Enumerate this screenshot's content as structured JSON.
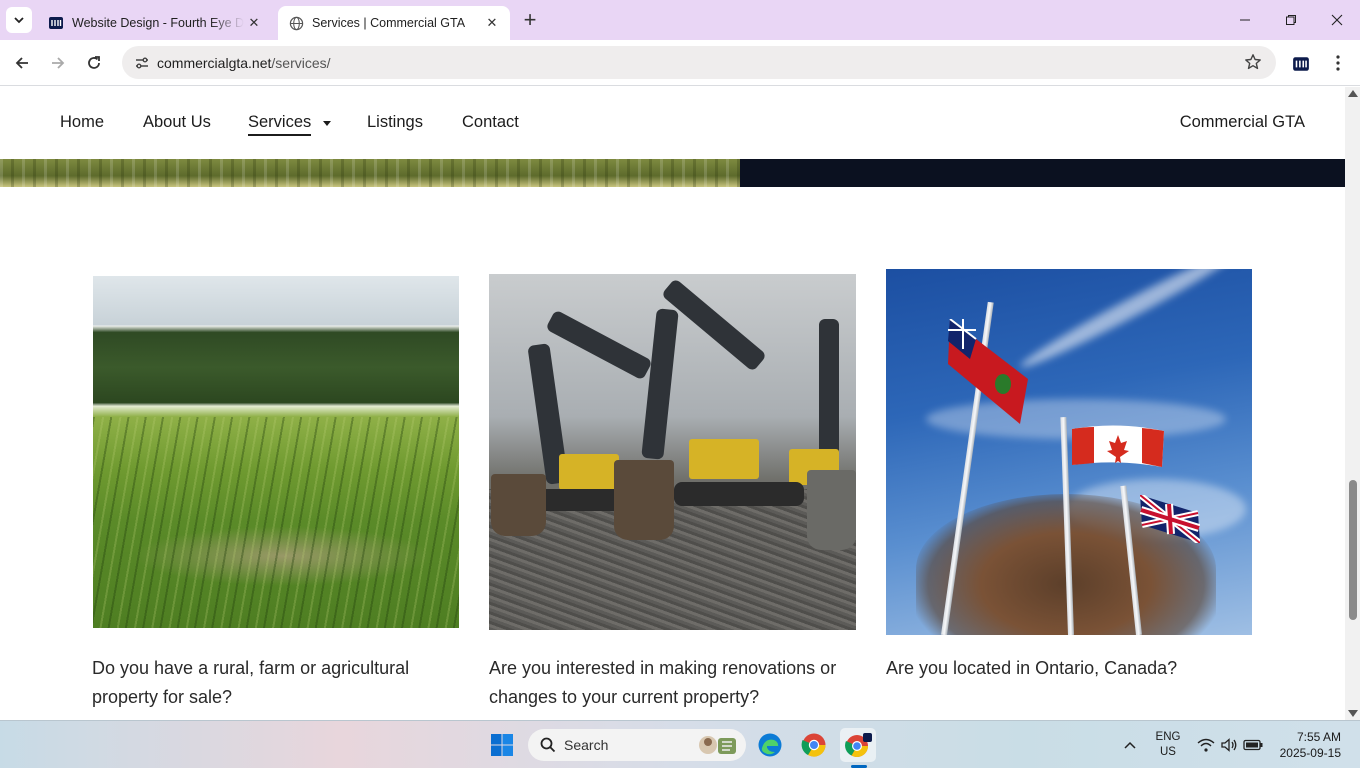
{
  "browser": {
    "tabs": [
      {
        "title": "Website Design - Fourth Eye Di",
        "active": false
      },
      {
        "title": "Services | Commercial GTA",
        "active": true
      }
    ],
    "url_domain": "commercialgta.net",
    "url_path": "/services/"
  },
  "site": {
    "nav": [
      "Home",
      "About Us",
      "Services",
      "Listings",
      "Contact"
    ],
    "current": "Services",
    "brand": "Commercial GTA"
  },
  "cards": [
    {
      "caption": "Do you have a rural, farm or agricultural property for sale?"
    },
    {
      "caption": "Are you interested in making renovations or changes to your current property?"
    },
    {
      "caption": "Are you located in Ontario, Canada?"
    }
  ],
  "taskbar": {
    "search_label": "Search",
    "language": "ENG",
    "region": "US",
    "time": "7:55 AM",
    "date": "2025-09-15"
  },
  "colors": {
    "tabstrip": "#e9d6f5",
    "banner_dark": "#0b1120",
    "accent": "#0067c0"
  }
}
